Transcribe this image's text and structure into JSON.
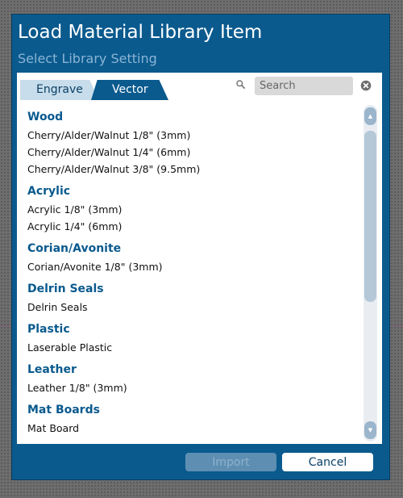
{
  "dialog": {
    "title": "Load Material Library Item",
    "subtitle": "Select Library Setting"
  },
  "tabs": [
    {
      "label": "Engrave",
      "selected": false
    },
    {
      "label": "Vector",
      "selected": true
    }
  ],
  "search": {
    "placeholder": "Search",
    "value": "",
    "search_icon": "search-icon",
    "clear_icon": "clear-icon"
  },
  "library": [
    {
      "category": "Wood",
      "items": [
        "Cherry/Alder/Walnut 1/8\" (3mm)",
        "Cherry/Alder/Walnut 1/4\" (6mm)",
        "Cherry/Alder/Walnut 3/8\" (9.5mm)"
      ]
    },
    {
      "category": "Acrylic",
      "items": [
        "Acrylic 1/8\" (3mm)",
        "Acrylic 1/4\" (6mm)"
      ]
    },
    {
      "category": "Corian/Avonite",
      "items": [
        "Corian/Avonite 1/8\" (3mm)"
      ]
    },
    {
      "category": "Delrin Seals",
      "items": [
        "Delrin Seals"
      ]
    },
    {
      "category": "Plastic",
      "items": [
        "Laserable Plastic"
      ]
    },
    {
      "category": "Leather",
      "items": [
        "Leather 1/8\" (3mm)"
      ]
    },
    {
      "category": "Mat Boards",
      "items": [
        "Mat Board"
      ]
    }
  ],
  "buttons": {
    "import_label": "Import",
    "import_enabled": false,
    "cancel_label": "Cancel"
  },
  "colors": {
    "dialog_background": "#0a5a8e",
    "category_text": "#0a5a8e",
    "inactive_tab": "#c8ddeb"
  }
}
